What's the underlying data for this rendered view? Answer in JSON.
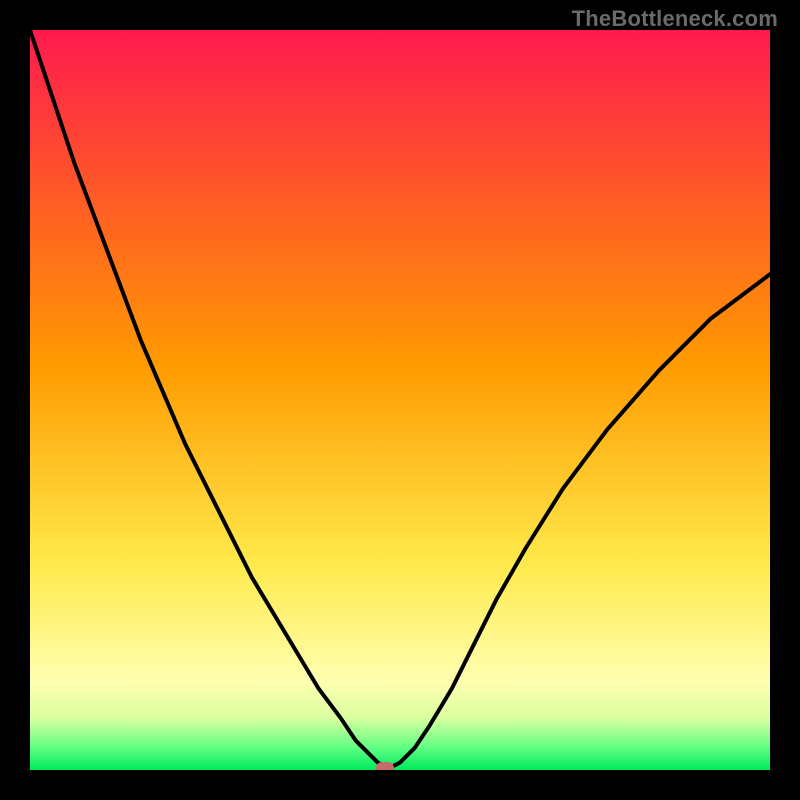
{
  "watermark": "TheBottleneck.com",
  "colors": {
    "frame": "#000000",
    "grad_top": "#ff1a4e",
    "grad_mid": "#ffb400",
    "grad_low": "#ffff6a",
    "grad_band_pale": "#f0ffb0",
    "grad_green": "#00e85c",
    "curve": "#000000",
    "marker": "#c76a6a"
  },
  "chart_data": {
    "type": "line",
    "title": "",
    "xlabel": "",
    "ylabel": "",
    "xlim": [
      0,
      100
    ],
    "ylim": [
      0,
      100
    ],
    "x": [
      0,
      3,
      6,
      9,
      12,
      15,
      18,
      21,
      24,
      27,
      30,
      33,
      36,
      39,
      42,
      44,
      46,
      47,
      48,
      49,
      50,
      52,
      54,
      57,
      60,
      63,
      67,
      72,
      78,
      85,
      92,
      100
    ],
    "values": [
      100,
      91,
      82,
      74,
      66,
      58,
      51,
      44,
      38,
      32,
      26,
      21,
      16,
      11,
      7,
      4,
      2,
      1,
      0.5,
      0.5,
      1,
      3,
      6,
      11,
      17,
      23,
      30,
      38,
      46,
      54,
      61,
      67
    ],
    "min_point": {
      "x": 48,
      "y": 0
    },
    "gradient_stops": [
      {
        "pct": 0,
        "color": "#ff1a4e"
      },
      {
        "pct": 45,
        "color": "#ff9a00"
      },
      {
        "pct": 72,
        "color": "#ffe94a"
      },
      {
        "pct": 88,
        "color": "#ffffb0"
      },
      {
        "pct": 93,
        "color": "#d9ff9f"
      },
      {
        "pct": 97,
        "color": "#5fff82"
      },
      {
        "pct": 100,
        "color": "#00e85c"
      }
    ]
  }
}
